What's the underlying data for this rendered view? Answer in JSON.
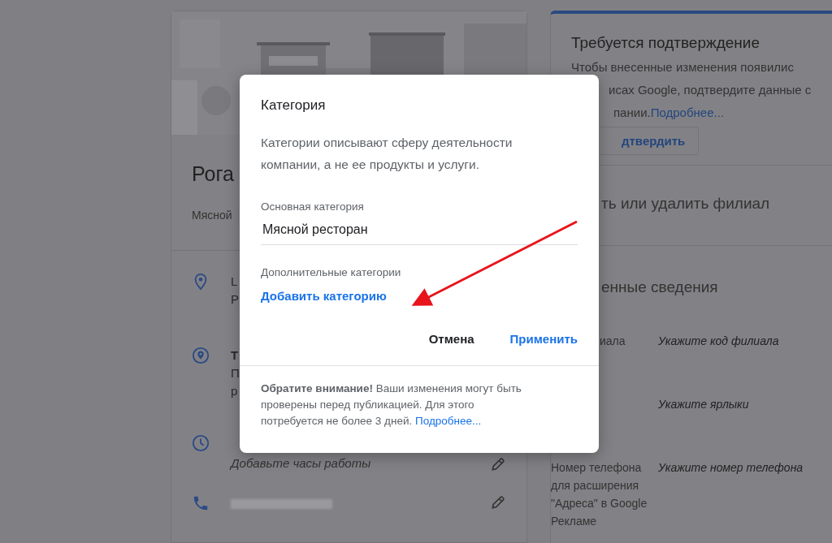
{
  "left_card": {
    "title": "Рога",
    "category": "Мясной",
    "rows": [
      {
        "kind": "location",
        "lines": [
          "L",
          "Р"
        ],
        "editable": false
      },
      {
        "kind": "pin",
        "lines": [
          "Т",
          "П",
          "р"
        ],
        "editable": false
      },
      {
        "kind": "hours",
        "lines": [
          "Добавьте часы работы"
        ],
        "editable": true
      },
      {
        "kind": "phone",
        "editable": true
      }
    ]
  },
  "right_card": {
    "title": "Требуется подтверждение",
    "text_lines": [
      "Чтобы внесенные изменения появилис",
      "исах Google, подтвердите данные с",
      "пании."
    ],
    "link": "Подробнее...",
    "button": "дтвердить",
    "section_1": "ть или удалить филиал",
    "section_2": "енные сведения",
    "fields": [
      {
        "label": "иала",
        "value": "Укажите код филиала"
      },
      {
        "value": "Укажите ярлыки"
      },
      {
        "label": "Номер телефона для расширения \"Адреса\" в Google Рекламе",
        "value": "Укажите номер телефона"
      }
    ]
  },
  "modal": {
    "title": "Категория",
    "description": "Категории описывают сферу деятельности компании, а не ее продукты и услуги.",
    "primary_label": "Основная категория",
    "primary_value": "Мясной ресторан",
    "secondary_label": "Дополнительные категории",
    "add_link": "Добавить категорию",
    "buttons": [
      {
        "label": "Отмена",
        "kind": "text"
      },
      {
        "label": "Применить",
        "kind": "primary"
      }
    ],
    "note": "**Обратите внимание!** Ваши изменения могут быть проверены перед публикацией. Для этого потребуется не более 3 дней.",
    "note_link": "Подробнее..."
  }
}
